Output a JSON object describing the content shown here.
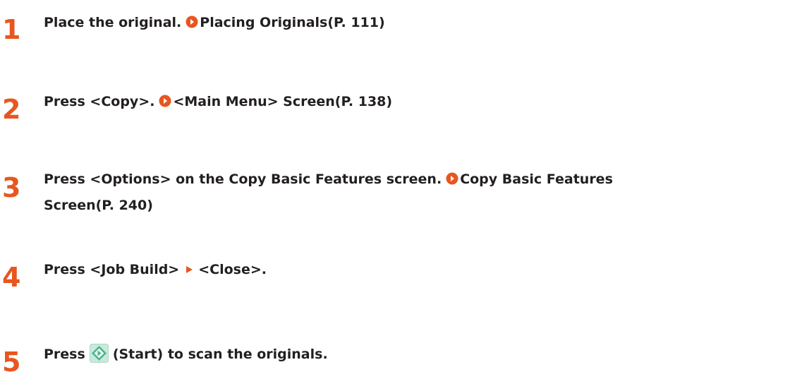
{
  "steps": [
    {
      "number": "1",
      "text": "Place the original.",
      "link": "Placing Originals(P. 111)"
    },
    {
      "number": "2",
      "text": "Press <Copy>.",
      "link": "<Main Menu> Screen(P. 138)"
    },
    {
      "number": "3",
      "text": "Press <Options> on the Copy Basic Features screen.",
      "link_line1": "Copy Basic Features",
      "link_line2": "Screen(P. 240)"
    },
    {
      "number": "4",
      "text_before": "Press <Job Build>",
      "text_after": "<Close>."
    },
    {
      "number": "5",
      "text_before": "Press",
      "text_after": "(Start) to scan the originals."
    }
  ],
  "colors": {
    "accent": "#e8561f",
    "start_button_green": "#4cb38a",
    "start_button_bg": "#c9e9dc",
    "text": "#231f20"
  },
  "icons": {
    "link_marker": "orange-circle-arrow-icon",
    "separator": "orange-triangle-icon",
    "start_key": "start-button-icon"
  }
}
